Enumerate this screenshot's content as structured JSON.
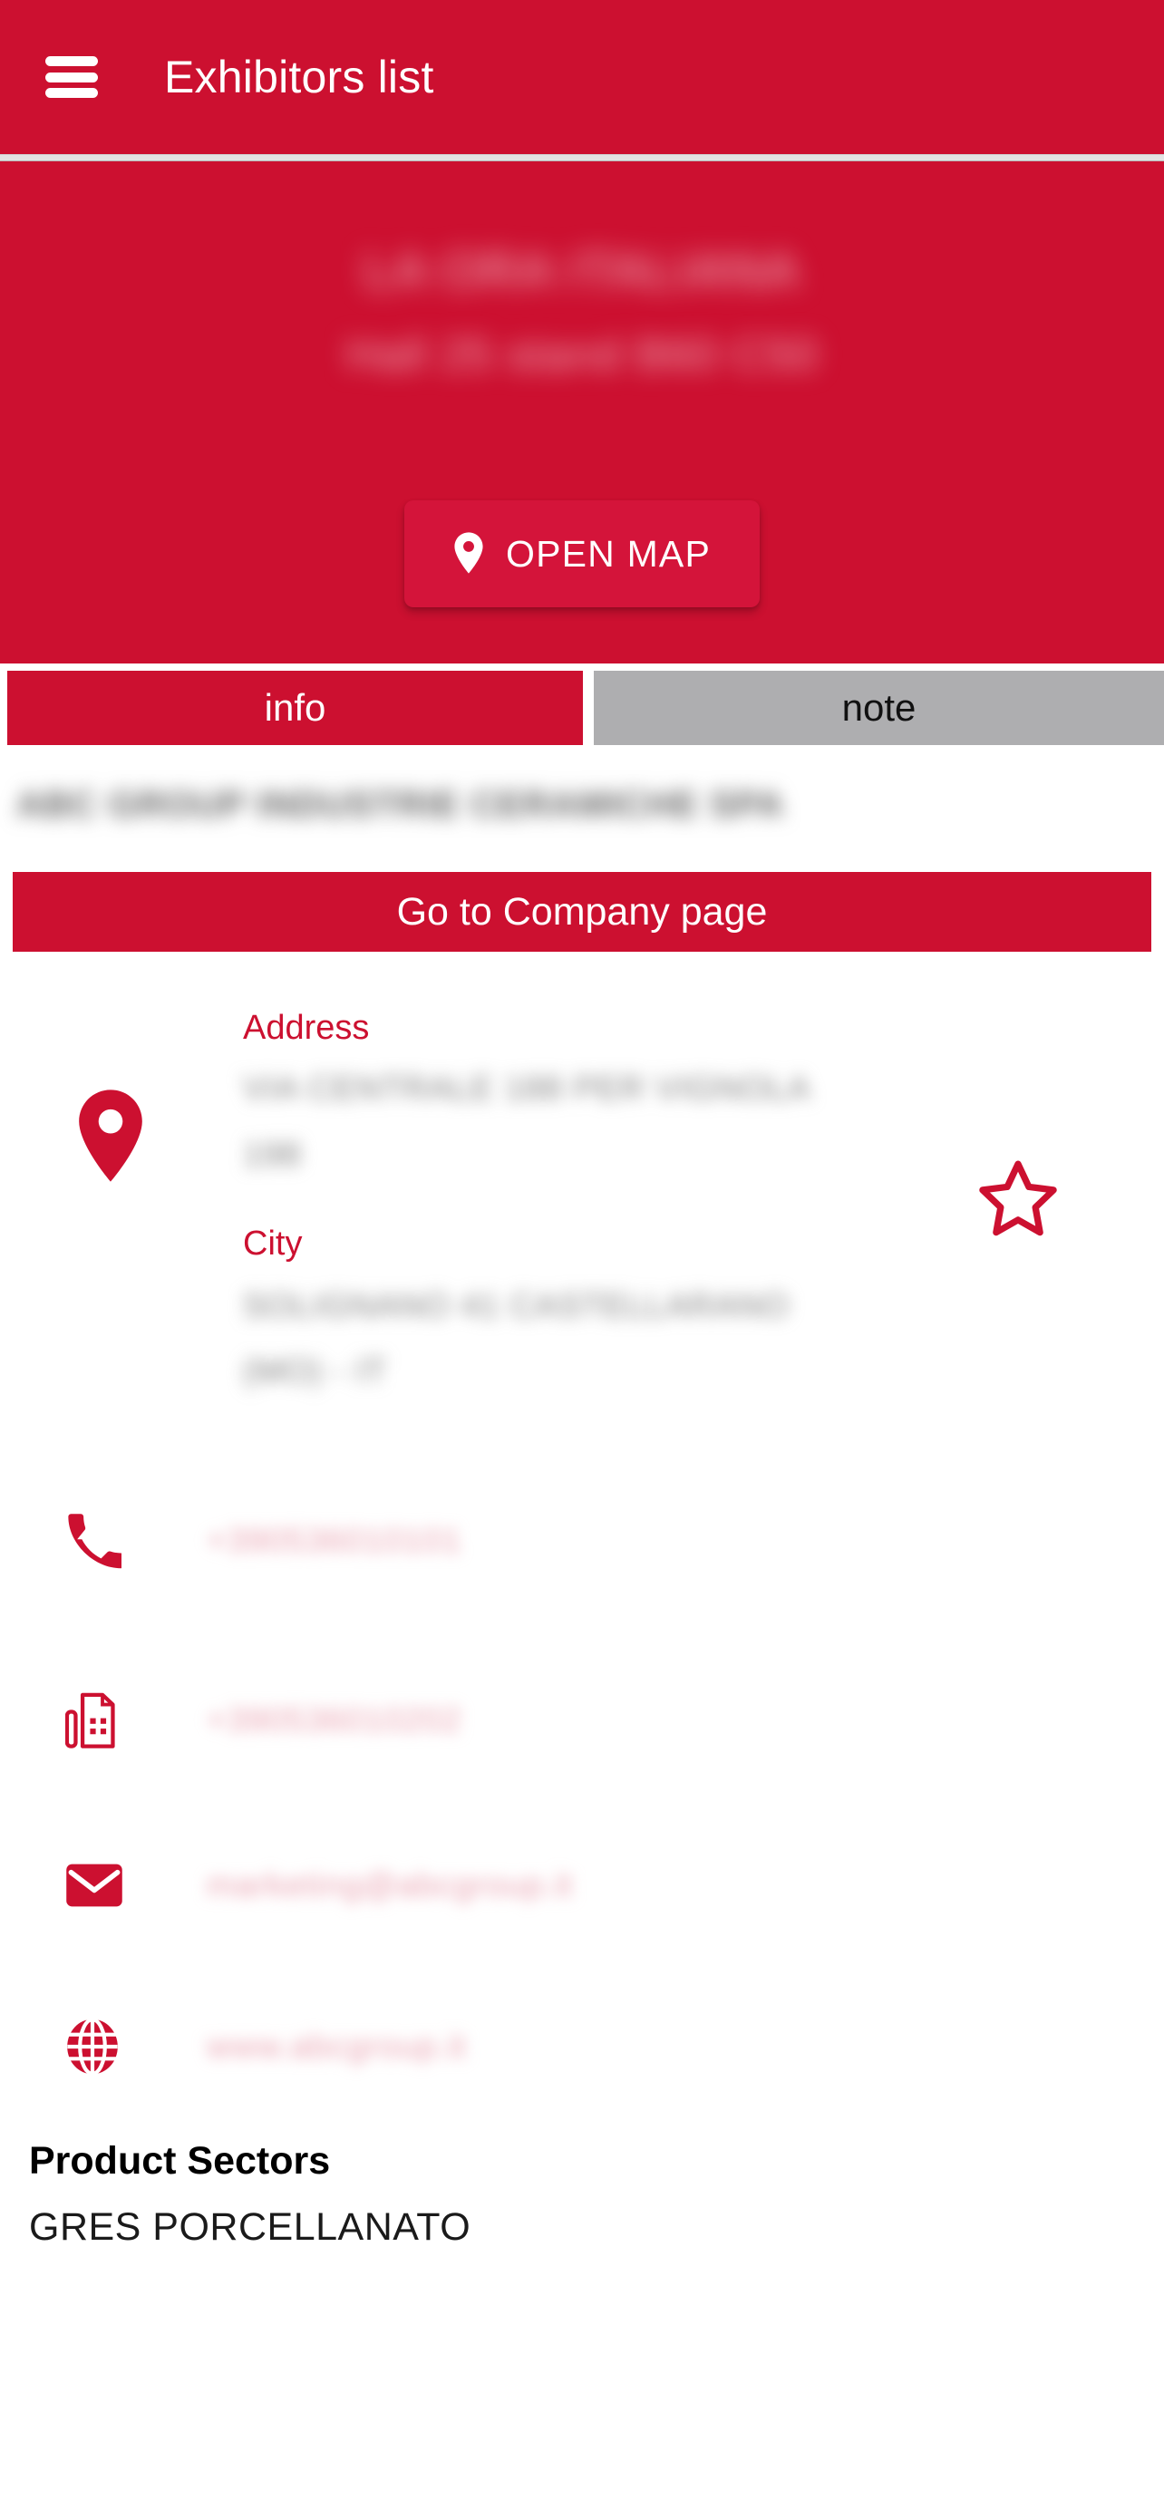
{
  "appbar": {
    "menu_icon": "hamburger-menu-icon",
    "title": "Exhibitors list"
  },
  "hero": {
    "exhibitor_name": "LA ORA ITALIANA",
    "stand_info": "Hall 25 stand B60 C50",
    "open_map": {
      "label": "OPEN MAP",
      "icon": "map-pin-icon"
    }
  },
  "tabs": [
    {
      "label": "info",
      "active": true
    },
    {
      "label": "note",
      "active": false
    }
  ],
  "company": {
    "name": "ABC GROUP INDUSTRIE CERAMICHE SPA",
    "go_to_page_label": "Go to Company page"
  },
  "location": {
    "pin_icon": "map-pin-icon",
    "favorite_icon": "star-outline-icon",
    "address_label": "Address",
    "address_lines": [
      "VIA CENTRALE 188 PER VIGNOLA",
      "198"
    ],
    "city_label": "City",
    "city_lines": [
      "SOLIGNANO 41 CASTELLARANO",
      "(MO) - IT"
    ]
  },
  "contacts": [
    {
      "icon": "phone-icon",
      "name": "phone",
      "value": "+390536010101"
    },
    {
      "icon": "fax-icon",
      "name": "fax",
      "value": "+390536010202"
    },
    {
      "icon": "email-icon",
      "name": "email",
      "value": "marketing@abcgroup.it"
    },
    {
      "icon": "globe-icon",
      "name": "website",
      "value": "www.abcgroup.it"
    }
  ],
  "product_sectors": {
    "title": "Product Sectors",
    "items": [
      "GRES PORCELLANATO"
    ]
  },
  "colors": {
    "brand_red": "#CC1030",
    "button_red": "#D4143A",
    "tab_inactive_gray": "#AEAEB0",
    "white": "#FFFFFF"
  }
}
